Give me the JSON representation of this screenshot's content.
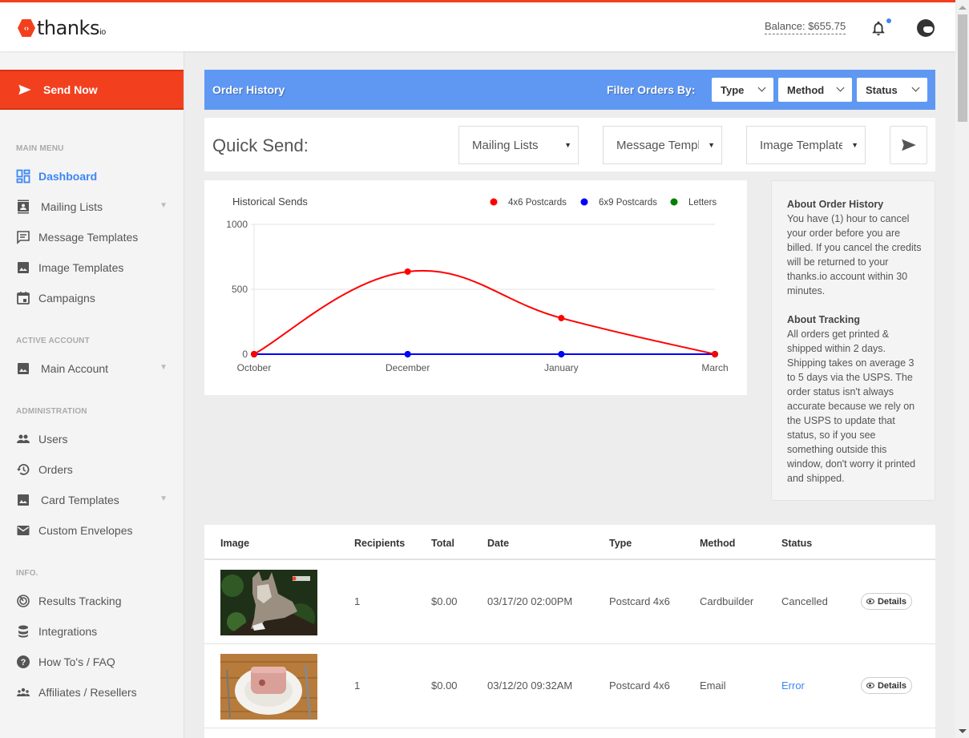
{
  "header": {
    "logo_text": "thanks",
    "logo_suffix": "io",
    "balance": "Balance: $655.75"
  },
  "sidebar": {
    "send_now": "Send Now",
    "sections": {
      "main_menu": "MAIN MENU",
      "active_account": "ACTIVE ACCOUNT",
      "administration": "ADMINISTRATION",
      "info": "INFO."
    },
    "items": {
      "dashboard": "Dashboard",
      "mailing_lists": "Mailing Lists",
      "message_templates": "Message Templates",
      "image_templates": "Image Templates",
      "campaigns": "Campaigns",
      "main_account": "Main Account",
      "users": "Users",
      "orders": "Orders",
      "card_templates": "Card Templates",
      "custom_envelopes": "Custom Envelopes",
      "results_tracking": "Results Tracking",
      "integrations": "Integrations",
      "howtos_faq": "How To's / FAQ",
      "affiliates": "Affiliates / Resellers"
    }
  },
  "order_bar": {
    "title": "Order History",
    "filter_label": "Filter Orders By:",
    "filters": [
      "Type",
      "Method",
      "Status"
    ]
  },
  "quick_send": {
    "title": "Quick Send:",
    "selects": [
      "Mailing Lists",
      "Message Templates",
      "Image Templates"
    ]
  },
  "chart_data": {
    "type": "line",
    "title": "Historical Sends",
    "categories": [
      "October",
      "December",
      "January",
      "March"
    ],
    "series": [
      {
        "name": "4x6 Postcards",
        "color": "#ff0000",
        "values": [
          0,
          636,
          278,
          0
        ]
      },
      {
        "name": "6x9 Postcards",
        "color": "#0000ff",
        "values": [
          0,
          0,
          0,
          0
        ]
      },
      {
        "name": "Letters",
        "color": "#008000",
        "values": [
          0,
          0,
          0,
          0
        ]
      }
    ],
    "yticks": [
      0,
      500,
      1000
    ],
    "ylim": [
      0,
      1000
    ],
    "xlabel": "",
    "ylabel": "",
    "grid": true,
    "legend": "top-right"
  },
  "info": {
    "order_history_title": "About Order History",
    "order_history_text": "You have (1) hour to cancel your order before you are billed. If you cancel the credits will be returned to your thanks.io account within 30 minutes.",
    "tracking_title": "About Tracking",
    "tracking_text": "All orders get printed & shipped within 2 days. Shipping takes on average 3 to 5 days via the USPS. The order status isn't always accurate because we rely on the USPS to update that status, so if you see something outside this window, don't worry it printed and shipped."
  },
  "table": {
    "headers": [
      "Image",
      "Recipients",
      "Total",
      "Date",
      "Type",
      "Method",
      "Status"
    ],
    "details_label": "Details",
    "rows": [
      {
        "image": "wolf-postcard",
        "recipients": "1",
        "total": "$0.00",
        "date": "03/17/20 02:00PM",
        "type": "Postcard 4x6",
        "method": "Cardbuilder",
        "status": "Cancelled"
      },
      {
        "image": "ham-plate-postcard",
        "recipients": "1",
        "total": "$0.00",
        "date": "03/12/20 09:32AM",
        "type": "Postcard 4x6",
        "method": "Email",
        "status": "Error"
      }
    ]
  },
  "colors": {
    "brand": "#f2401f",
    "accent": "#5f98f3",
    "link": "#3d86f5"
  }
}
